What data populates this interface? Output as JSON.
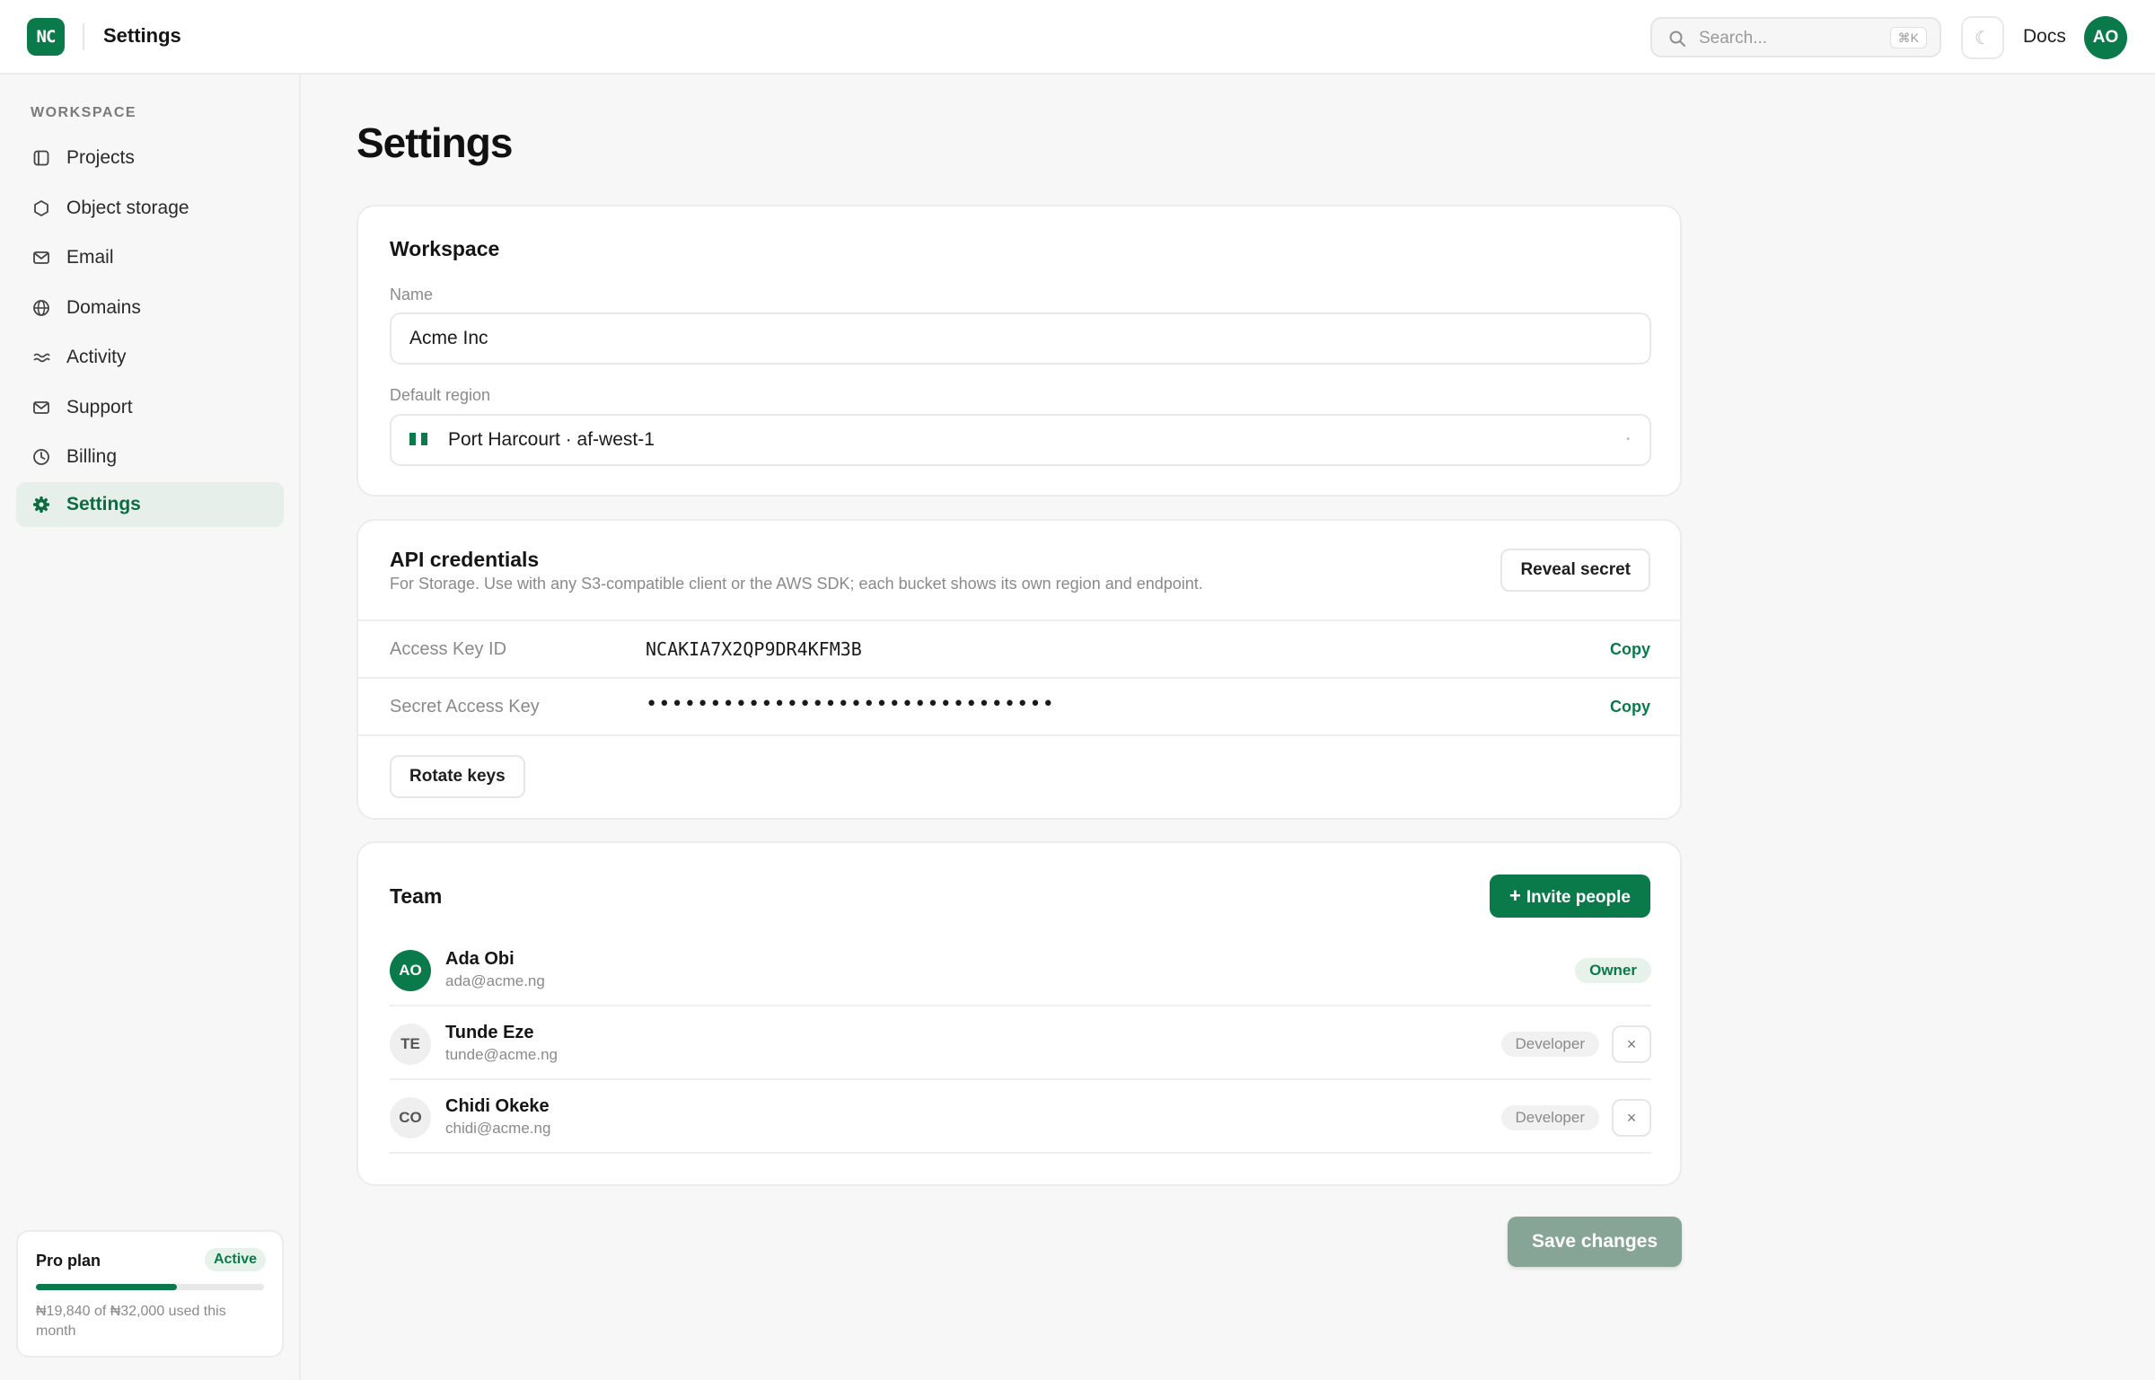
{
  "colors": {
    "brand": "#0b7a4b",
    "active_bg": "#e6efe9",
    "muted": "#8a8a8a",
    "save_disabled": "#86a596"
  },
  "header": {
    "logo_text": "NC",
    "title": "Settings",
    "search": {
      "placeholder": "Search...",
      "shortcut": "⌘K",
      "icon": "search-icon"
    },
    "theme_icon": "moon-icon",
    "docs_label": "Docs",
    "avatar_initials": "AO"
  },
  "sidebar": {
    "section_label": "WORKSPACE",
    "items": [
      {
        "label": "Projects",
        "icon": "folder-icon",
        "active": false
      },
      {
        "label": "Object storage",
        "icon": "cube-icon",
        "active": false
      },
      {
        "label": "Email",
        "icon": "mail-icon",
        "active": false
      },
      {
        "label": "Domains",
        "icon": "globe-icon",
        "active": false
      },
      {
        "label": "Activity",
        "icon": "activity-icon",
        "active": false
      },
      {
        "label": "Support",
        "icon": "support-mail-icon",
        "active": false
      },
      {
        "label": "Billing",
        "icon": "clock-icon",
        "active": false
      },
      {
        "label": "Settings",
        "icon": "gear-icon",
        "active": true
      }
    ],
    "plan": {
      "name": "Pro plan",
      "status": "Active",
      "usage_fraction": 0.62,
      "usage_text": "₦19,840 of ₦32,000 used this month"
    }
  },
  "main": {
    "title": "Settings",
    "workspace": {
      "title": "Workspace",
      "name_label": "Name",
      "name_value": "Acme Inc",
      "region_label": "Default region",
      "region_value": "Port Harcourt · af-west-1"
    },
    "credentials": {
      "title": "API credentials",
      "description": "For Storage. Use with any S3-compatible client or the AWS SDK; each bucket shows its own region and endpoint.",
      "reveal_label": "Reveal secret",
      "rows": [
        {
          "key": "Access Key ID",
          "value": "NCAKIA7X2QP9DR4KFM3B",
          "copy_label": "Copy"
        },
        {
          "key": "Secret Access Key",
          "value": "••••••••••••••••••••••••••••••••",
          "copy_label": "Copy"
        }
      ],
      "rotate_label": "Rotate keys"
    },
    "team": {
      "title": "Team",
      "invite_label": "Invite people",
      "members": [
        {
          "initials": "AO",
          "name": "Ada Obi",
          "email": "ada@acme.ng",
          "role": "Owner"
        },
        {
          "initials": "TE",
          "name": "Tunde Eze",
          "email": "tunde@acme.ng",
          "role": "Developer",
          "remove": "×"
        },
        {
          "initials": "CO",
          "name": "Chidi Okeke",
          "email": "chidi@acme.ng",
          "role": "Developer",
          "remove": "×"
        }
      ]
    },
    "save_label": "Save changes"
  }
}
